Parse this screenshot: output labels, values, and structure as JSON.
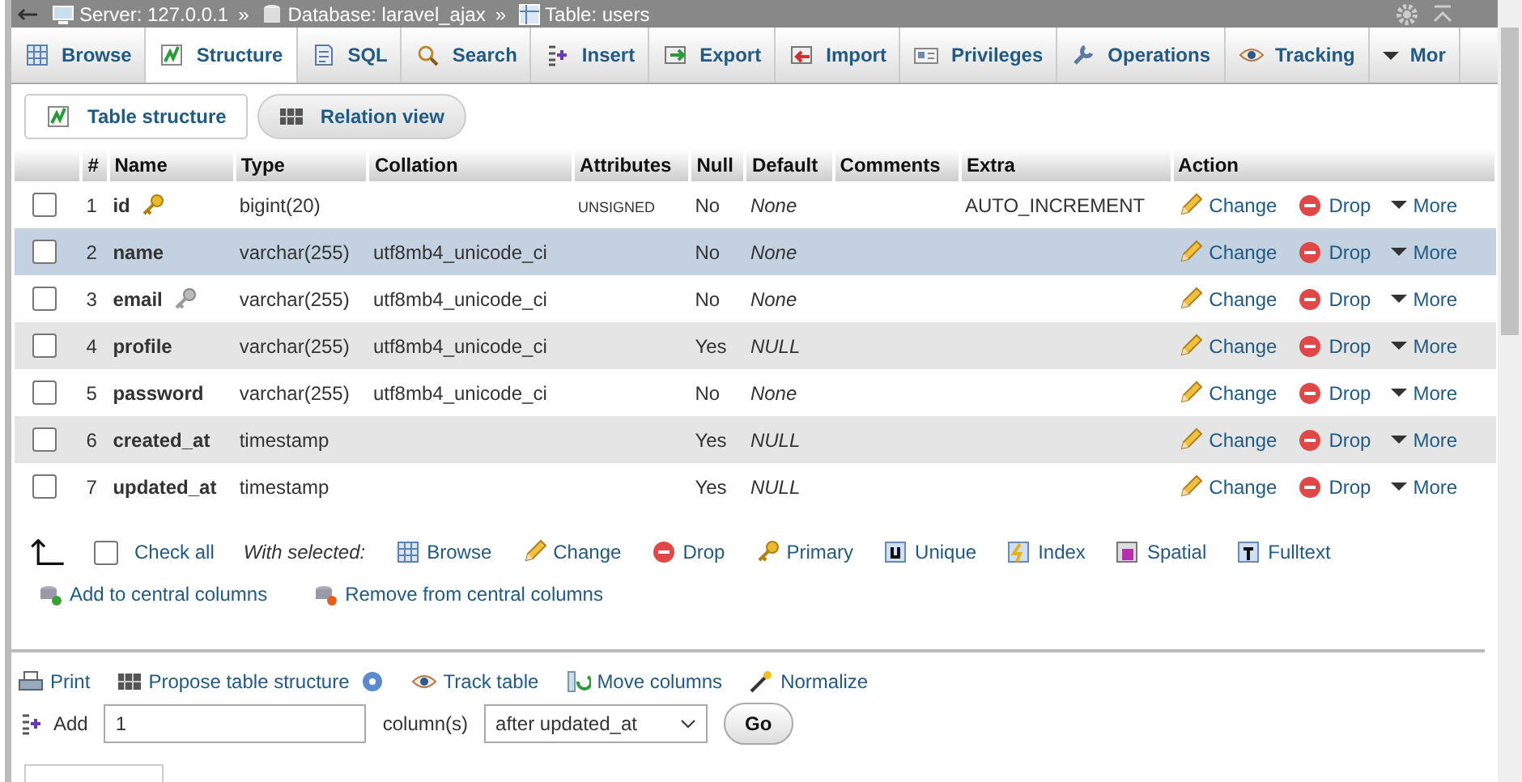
{
  "breadcrumb": {
    "items": [
      {
        "label": "Server: 127.0.0.1"
      },
      {
        "label": "Database: laravel_ajax"
      },
      {
        "label": "Table: users"
      }
    ],
    "separators": [
      "»",
      "»"
    ]
  },
  "tabs": [
    {
      "label": "Browse",
      "selected": false
    },
    {
      "label": "Structure",
      "selected": true
    },
    {
      "label": "SQL",
      "selected": false
    },
    {
      "label": "Search",
      "selected": false
    },
    {
      "label": "Insert",
      "selected": false
    },
    {
      "label": "Export",
      "selected": false
    },
    {
      "label": "Import",
      "selected": false
    },
    {
      "label": "Privileges",
      "selected": false
    },
    {
      "label": "Operations",
      "selected": false
    },
    {
      "label": "Tracking",
      "selected": false
    },
    {
      "label": "Mor",
      "selected": false
    }
  ],
  "subtabs": [
    {
      "label": "Table structure",
      "selected": true
    },
    {
      "label": "Relation view",
      "selected": false
    }
  ],
  "table": {
    "columns": [
      "#",
      "Name",
      "Type",
      "Collation",
      "Attributes",
      "Null",
      "Default",
      "Comments",
      "Extra",
      "Action"
    ],
    "rows": [
      {
        "checked": false,
        "selected": false,
        "num": "1",
        "name": "id",
        "kind": "primary_key",
        "type": "bigint(20)",
        "attributes": "UNSIGNED",
        "null": "No",
        "default": "None",
        "extra": "AUTO_INCREMENT",
        "actions": [
          "Change",
          "Drop",
          "More"
        ]
      },
      {
        "checked": false,
        "selected": true,
        "num": "2",
        "name": "name",
        "kind": "plain",
        "type": "varchar(255)",
        "collation": "utf8mb4_unicode_ci",
        "null": "No",
        "default": "None",
        "actions": [
          "Change",
          "Drop",
          "More"
        ]
      },
      {
        "checked": false,
        "selected": false,
        "num": "3",
        "name": "email",
        "kind": "unique_key",
        "type": "varchar(255)",
        "collation": "utf8mb4_unicode_ci",
        "null": "No",
        "default": "None",
        "actions": [
          "Change",
          "Drop",
          "More"
        ]
      },
      {
        "checked": false,
        "selected": false,
        "num": "4",
        "name": "profile",
        "kind": "plain",
        "type": "varchar(255)",
        "collation": "utf8mb4_unicode_ci",
        "null": "Yes",
        "default": "NULL",
        "actions": [
          "Change",
          "Drop",
          "More"
        ]
      },
      {
        "checked": false,
        "selected": false,
        "num": "5",
        "name": "password",
        "kind": "plain",
        "type": "varchar(255)",
        "collation": "utf8mb4_unicode_ci",
        "null": "No",
        "default": "None",
        "actions": [
          "Change",
          "Drop",
          "More"
        ]
      },
      {
        "checked": false,
        "selected": false,
        "num": "6",
        "name": "created_at",
        "kind": "plain",
        "type": "timestamp",
        "null": "Yes",
        "default": "NULL",
        "actions": [
          "Change",
          "Drop",
          "More"
        ]
      },
      {
        "checked": false,
        "selected": false,
        "num": "7",
        "name": "updated_at",
        "kind": "plain",
        "type": "timestamp",
        "null": "Yes",
        "default": "NULL",
        "actions": [
          "Change",
          "Drop",
          "More"
        ]
      }
    ]
  },
  "check_all": {
    "label": "Check all",
    "checked": false
  },
  "with_selected": "With selected:",
  "bulk_actions": [
    "Browse",
    "Change",
    "Drop",
    "Primary",
    "Unique",
    "Index",
    "Spatial",
    "Fulltext"
  ],
  "central_columns": [
    "Add to central columns",
    "Remove from central columns"
  ],
  "table_operations": [
    "Print",
    "Propose table structure",
    "Track table",
    "Move columns",
    "Normalize"
  ],
  "add_columns": {
    "label": "Add",
    "value": "1",
    "unit": "column(s)",
    "position": "after updated_at",
    "button": "Go"
  }
}
